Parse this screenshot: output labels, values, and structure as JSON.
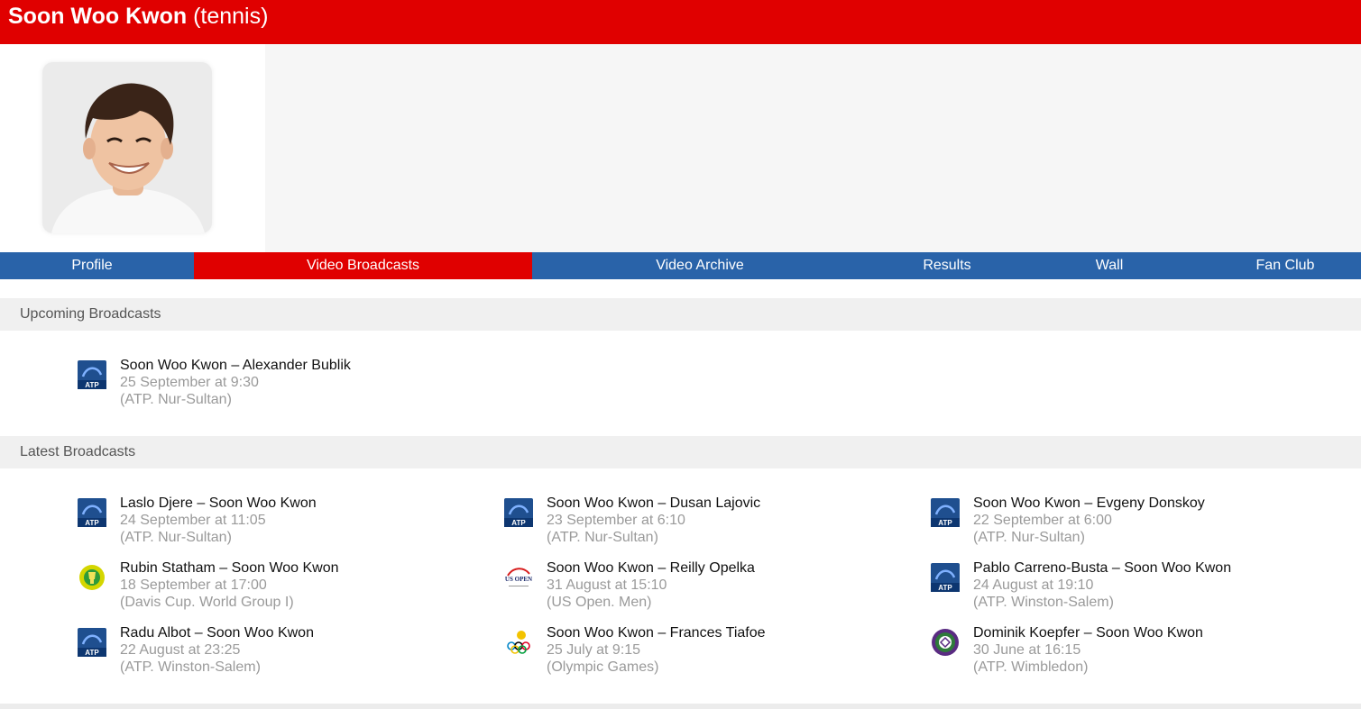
{
  "header": {
    "name": "Soon Woo Kwon",
    "sport": "(tennis)"
  },
  "colors": {
    "accent_red": "#e00000",
    "nav_blue": "#2963a9",
    "section_grey": "#f0f0f0"
  },
  "nav": {
    "tabs": [
      {
        "label": "Profile",
        "active": false
      },
      {
        "label": "Video Broadcasts",
        "active": true
      },
      {
        "label": "Video Archive",
        "active": false
      },
      {
        "label": "Results",
        "active": false
      },
      {
        "label": "Wall",
        "active": false
      },
      {
        "label": "Fan Club",
        "active": false
      }
    ]
  },
  "upcoming": {
    "heading": "Upcoming Broadcasts",
    "items": [
      {
        "match": "Soon Woo Kwon – Alexander Bublik",
        "when": "25 September at 9:30",
        "event": "(ATP. Nur-Sultan)",
        "icon": "atp-logo-icon"
      }
    ]
  },
  "latest": {
    "heading": "Latest Broadcasts",
    "items": [
      {
        "match": "Laslo Djere – Soon Woo Kwon",
        "when": "24 September at 11:05",
        "event": "(ATP. Nur-Sultan)",
        "icon": "atp-logo-icon"
      },
      {
        "match": "Soon Woo Kwon – Dusan Lajovic",
        "when": "23 September at 6:10",
        "event": "(ATP. Nur-Sultan)",
        "icon": "atp-logo-icon"
      },
      {
        "match": "Soon Woo Kwon – Evgeny Donskoy",
        "when": "22 September at 6:00",
        "event": "(ATP. Nur-Sultan)",
        "icon": "atp-logo-icon"
      },
      {
        "match": "Rubin Statham – Soon Woo Kwon",
        "when": "18 September at 17:00",
        "event": "(Davis Cup. World Group I)",
        "icon": "davis-cup-logo-icon"
      },
      {
        "match": "Soon Woo Kwon – Reilly Opelka",
        "when": "31 August at 15:10",
        "event": "(US Open. Men)",
        "icon": "us-open-logo-icon"
      },
      {
        "match": "Pablo Carreno-Busta – Soon Woo Kwon",
        "when": "24 August at 19:10",
        "event": "(ATP. Winston-Salem)",
        "icon": "atp-logo-icon"
      },
      {
        "match": "Radu Albot – Soon Woo Kwon",
        "when": "22 August at 23:25",
        "event": "(ATP. Winston-Salem)",
        "icon": "atp-logo-icon"
      },
      {
        "match": "Soon Woo Kwon – Frances Tiafoe",
        "when": "25 July at 9:15",
        "event": "(Olympic Games)",
        "icon": "olympic-rings-icon"
      },
      {
        "match": "Dominik Koepfer – Soon Woo Kwon",
        "when": "30 June at 16:15",
        "event": "(ATP. Wimbledon)",
        "icon": "wimbledon-logo-icon"
      }
    ]
  }
}
